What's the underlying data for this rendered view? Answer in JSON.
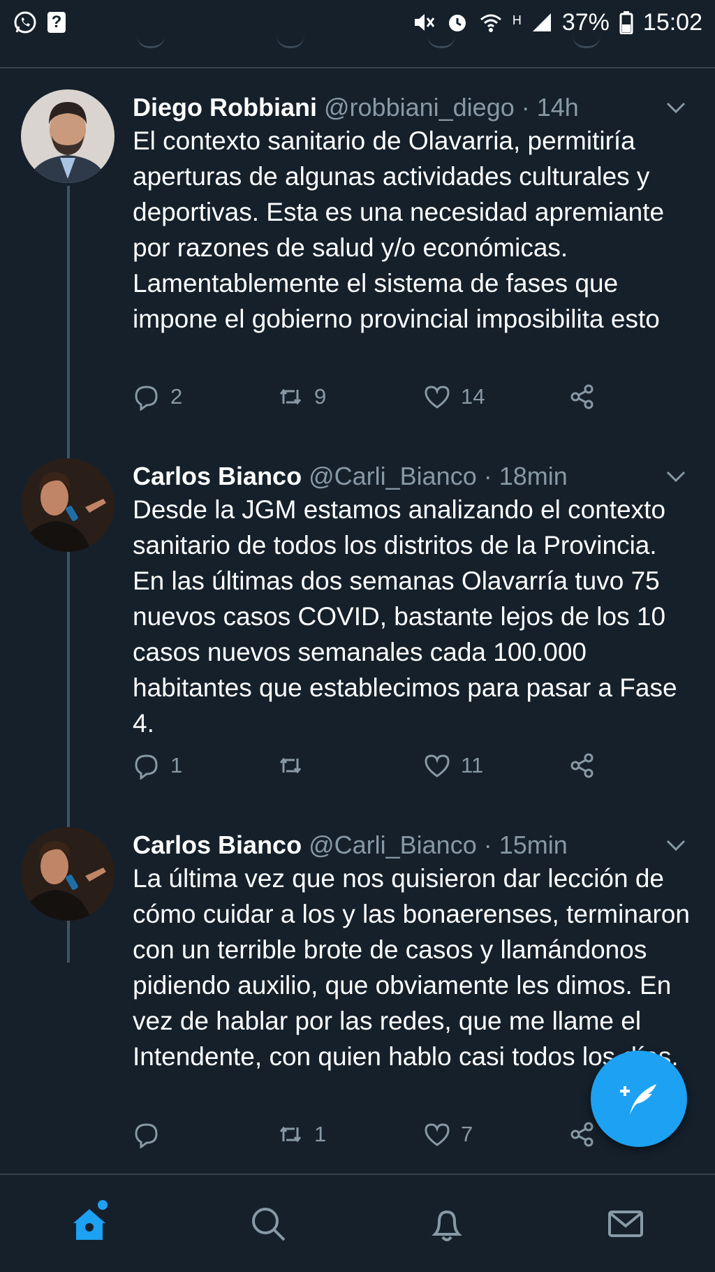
{
  "status_bar": {
    "left_icons": [
      "whatsapp-icon",
      "unknown-app-icon"
    ],
    "right_icons": [
      "mute-icon",
      "alarm-icon",
      "wifi-icon",
      "signal-icon",
      "battery-icon"
    ],
    "network_label": "H",
    "battery": "37%",
    "time": "15:02"
  },
  "tweets": [
    {
      "name": "Diego Robbiani",
      "handle": "@robbiani_diego",
      "time": "· 14h",
      "text": "El contexto sanitario de Olavarria, permitiría aperturas de algunas actividades culturales y deportivas. Esta es una necesidad apremiante por razones de salud y/o económicas. Lamentablemente el sistema de fases que impone el gobierno provincial imposibilita esto",
      "replies": "2",
      "retweets": "9",
      "likes": "14"
    },
    {
      "name": "Carlos Bianco",
      "handle": "@Carli_Bianco",
      "time": "· 18min",
      "text": "Desde la JGM estamos analizando el contexto sanitario de todos los distritos de la Provincia. En las últimas dos semanas Olavarría tuvo 75 nuevos casos COVID, bastante lejos de los 10 casos nuevos semanales cada 100.000 habitantes que establecimos para pasar a Fase 4.",
      "replies": "1",
      "retweets": "",
      "likes": "11"
    },
    {
      "name": "Carlos Bianco",
      "handle": "@Carli_Bianco",
      "time": "· 15min",
      "text": "La última vez que nos quisieron dar lección de cómo cuidar a los y las bonaerenses, terminaron con un terrible brote de casos y llamándonos pidiendo auxilio, que obviamente les dimos. En vez de hablar por las redes, que me llame el Intendente, con quien hablo casi todos los días.",
      "replies": "",
      "retweets": "1",
      "likes": "7"
    }
  ],
  "compose_button": {
    "icon": "compose-tweet-icon"
  },
  "bottom_nav": [
    "home-icon",
    "search-icon",
    "notifications-icon",
    "messages-icon"
  ],
  "colors": {
    "background": "#15202b",
    "accent": "#1da1f2",
    "secondary_text": "#8899a6",
    "divider": "#38444d"
  }
}
